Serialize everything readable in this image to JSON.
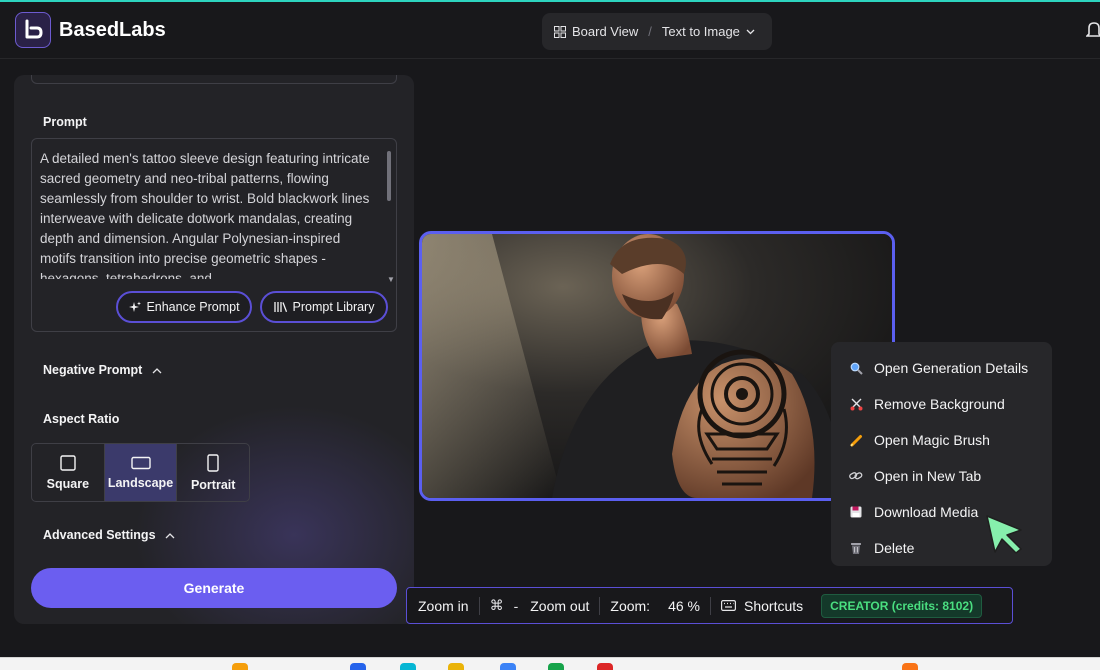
{
  "app": {
    "name": "BasedLabs"
  },
  "breadcrumb": {
    "view": "Board View",
    "separator": "/",
    "page": "Text to Image"
  },
  "panel": {
    "prompt_label": "Prompt",
    "prompt_text": "A detailed men's tattoo sleeve design featuring intricate sacred geometry and neo-tribal patterns, flowing seamlessly from shoulder to wrist. Bold blackwork lines interweave with delicate dotwork mandalas, creating depth and dimension. Angular Polynesian-inspired motifs transition into precise geometric shapes - hexagons, tetrahedrons, and",
    "enhance_label": "Enhance Prompt",
    "library_label": "Prompt Library",
    "negative_label": "Negative Prompt",
    "aspect_label": "Aspect Ratio",
    "aspect_options": [
      {
        "label": "Square",
        "selected": false
      },
      {
        "label": "Landscape",
        "selected": true
      },
      {
        "label": "Portrait",
        "selected": false
      }
    ],
    "advanced_label": "Advanced Settings",
    "generate_label": "Generate"
  },
  "context_menu": {
    "items": [
      {
        "label": "Open Generation Details",
        "icon": "magnifier-icon"
      },
      {
        "label": "Remove Background",
        "icon": "scissors-icon"
      },
      {
        "label": "Open Magic Brush",
        "icon": "pencil-icon"
      },
      {
        "label": "Open in New Tab",
        "icon": "link-icon"
      },
      {
        "label": "Download Media",
        "icon": "floppy-disk-icon"
      },
      {
        "label": "Delete",
        "icon": "trash-icon"
      }
    ]
  },
  "zoombar": {
    "zoom_in_label": "Zoom in",
    "cmd_key": "⌘",
    "minus_key": "-",
    "zoom_out_label": "Zoom out",
    "zoom_label": "Zoom:",
    "zoom_value": "46 %",
    "shortcuts_label": "Shortcuts",
    "credits_badge": "CREATOR (credits: 8102)"
  },
  "colors": {
    "accent": "#6b5ef0",
    "selected_ratio": "#3b3a6b",
    "credits_green": "#4ade80"
  }
}
